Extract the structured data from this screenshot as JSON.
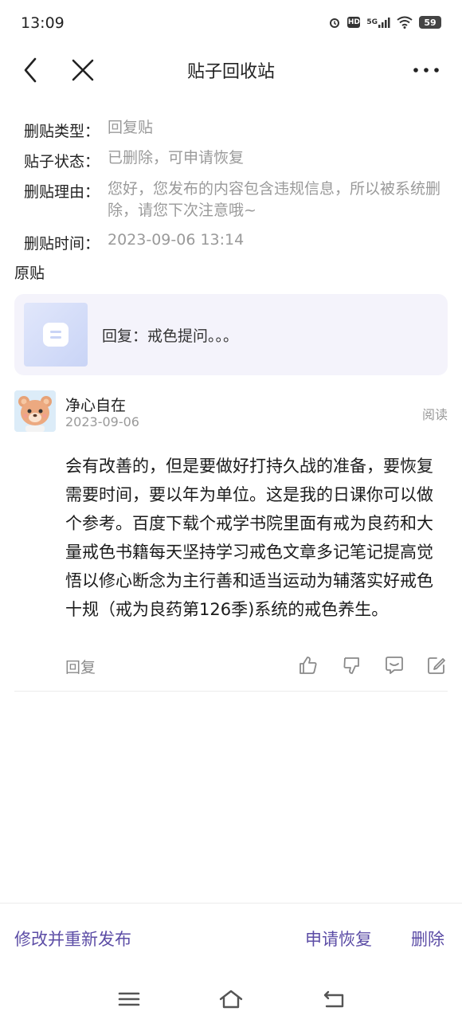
{
  "status_bar": {
    "time": "13:09",
    "battery": "59",
    "hd": "HD",
    "network": "5G"
  },
  "nav": {
    "title": "贴子回收站"
  },
  "info": {
    "rows": [
      {
        "label": "删贴类型：",
        "value": "回复贴"
      },
      {
        "label": "贴子状态：",
        "value": "已删除，可申请恢复"
      },
      {
        "label": "删贴理由：",
        "value": "您好，您发布的内容包含违规信息，所以被系统删除，请您下次注意哦~"
      },
      {
        "label": "删贴时间：",
        "value": "2023-09-06 13:14"
      }
    ],
    "original_label": "原贴"
  },
  "original_post": {
    "text": "回复：戒色提问。。。"
  },
  "reply": {
    "user_name": "净心自在",
    "date": "2023-09-06",
    "read_label": "阅读",
    "body": " 会有改善的，但是要做好打持久战的准备，要恢复需要时间，要以年为单位。这是我的日课你可以做个参考。百度下载个戒学书院里面有戒为良药和大量戒色书籍每天坚持学习戒色文章多记笔记提高觉悟以修心断念为主行善和适当运动为辅落实好戒色十规（戒为良药第126季)系统的戒色养生。",
    "reply_label": "回复",
    "icons": [
      "thumbs-up-icon",
      "thumbs-down-icon",
      "comment-icon",
      "edit-icon"
    ]
  },
  "bottom_bar": {
    "edit_repost": "修改并重新发布",
    "request_restore": "申请恢复",
    "delete": "删除"
  },
  "colors": {
    "accent": "#5c4da6",
    "muted": "#9a9a9a",
    "card_bg": "#f4f3fb"
  }
}
